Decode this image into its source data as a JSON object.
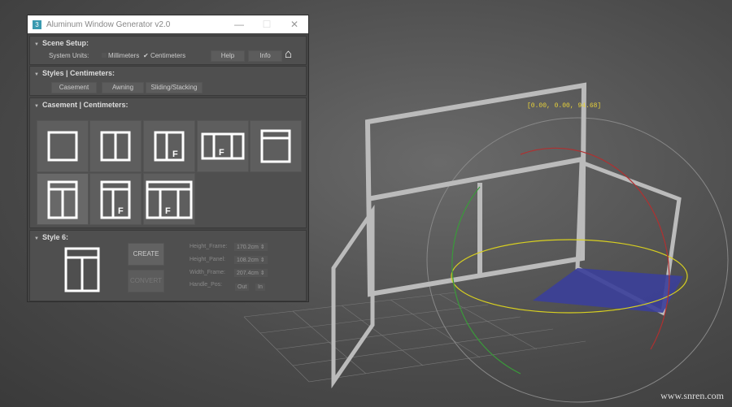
{
  "window": {
    "title": "Aluminum Window Generator v2.0",
    "app_icon": "3",
    "minimize": "—",
    "maximize": "☐",
    "close": "✕"
  },
  "scene_setup": {
    "title": "Scene Setup:",
    "units_label": "System Units:",
    "mm_label": "Millimeters",
    "mm_checked": false,
    "cm_label": "Centimeters",
    "cm_checked": true,
    "help": "Help",
    "info": "Info",
    "home_icon": "home-icon"
  },
  "styles": {
    "title": "Styles | Centimeters:",
    "buttons": [
      "Casement",
      "Awning",
      "Sliding/Stacking"
    ]
  },
  "casement": {
    "title": "Casement | Centimeters:",
    "thumb_mark": "F"
  },
  "style6": {
    "title": "Style 6:",
    "create": "CREATE",
    "convert": "CONVERT",
    "fields": [
      {
        "label": "Height_Frame:",
        "value": "170.2cm"
      },
      {
        "label": "Height_Panel:",
        "value": "108.2cm"
      },
      {
        "label": "Width_Frame:",
        "value": "207.4cm"
      }
    ],
    "handle_label": "Handle_Pos:",
    "handle_out": "Out",
    "handle_in": "In"
  },
  "viewport": {
    "coord": "[0.00, 0.00, 94.68]"
  },
  "watermark": "www.snren.com"
}
